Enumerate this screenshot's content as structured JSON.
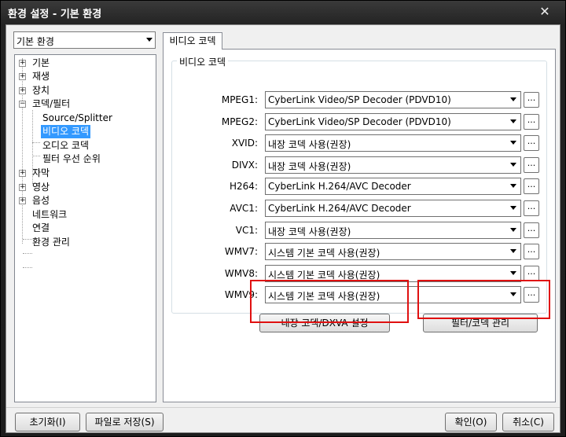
{
  "window": {
    "title": "환경 설정 - 기본 환경",
    "close_symbol": "✕"
  },
  "category_dropdown": {
    "value": "기본 환경"
  },
  "tree": {
    "items": [
      {
        "label": "기본",
        "expander": "+"
      },
      {
        "label": "재생",
        "expander": "+"
      },
      {
        "label": "장치",
        "expander": "+"
      },
      {
        "label": "코덱/필터",
        "expander": "−"
      },
      {
        "label": "Source/Splitter"
      },
      {
        "label": "비디오 코덱"
      },
      {
        "label": "오디오 코덱"
      },
      {
        "label": "필터 우선 순위"
      },
      {
        "label": "자막",
        "expander": "+"
      },
      {
        "label": "영상",
        "expander": "+"
      },
      {
        "label": "음성",
        "expander": "+"
      },
      {
        "label": "네트워크"
      },
      {
        "label": "연결"
      },
      {
        "label": "환경 관리"
      }
    ],
    "selected": "비디오 코덱"
  },
  "tab": {
    "label": "비디오 코덱"
  },
  "group": {
    "legend": "비디오 코덱",
    "rows": [
      {
        "label": "MPEG1:",
        "value": "CyberLink Video/SP Decoder (PDVD10)"
      },
      {
        "label": "MPEG2:",
        "value": "CyberLink Video/SP Decoder (PDVD10)"
      },
      {
        "label": "XVID:",
        "value": "내장 코덱 사용(권장)"
      },
      {
        "label": "DIVX:",
        "value": "내장 코덱 사용(권장)"
      },
      {
        "label": "H264:",
        "value": "CyberLink H.264/AVC Decoder"
      },
      {
        "label": "AVC1:",
        "value": "CyberLink H.264/AVC Decoder"
      },
      {
        "label": "VC1:",
        "value": "내장 코덱 사용(권장)"
      },
      {
        "label": "WMV7:",
        "value": "시스템 기본 코덱 사용(권장)"
      },
      {
        "label": "WMV8:",
        "value": "시스템 기본 코덱 사용(권장)"
      },
      {
        "label": "WMV9:",
        "value": "시스템 기본 코덱 사용(권장)"
      }
    ],
    "dots_label": "...",
    "internal_codec_button": "내장 코덱/DXVA 설정",
    "filter_manage_button": "필터/코덱 관리"
  },
  "footer": {
    "reset_button": "초기화(I)",
    "save_file_button": "파일로 저장(S)",
    "ok_button": "확인(O)",
    "cancel_button": "취소(C)"
  },
  "colors": {
    "highlight_box": "#e01010",
    "selection": "#3399ff"
  }
}
